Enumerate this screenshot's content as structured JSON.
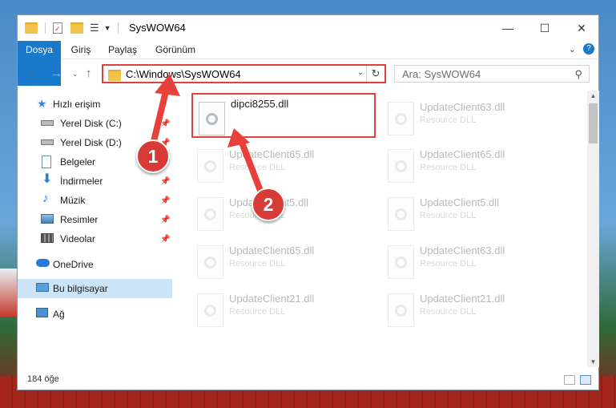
{
  "window": {
    "title": "SysWOW64",
    "controls": {
      "minimize": "—",
      "maximize": "☐",
      "close": "✕"
    }
  },
  "ribbon": {
    "tabs": [
      "Dosya",
      "Giriş",
      "Paylaş",
      "Görünüm"
    ],
    "help": "?"
  },
  "nav": {
    "address": "C:\\Windows\\SysWOW64",
    "search_placeholder": "Ara: SysWOW64"
  },
  "sidebar": {
    "items": [
      {
        "label": "Hızlı erişim",
        "icon": "star-icon"
      },
      {
        "label": "Yerel Disk (C:)",
        "icon": "drive-icon",
        "pinned": true
      },
      {
        "label": "Yerel Disk (D:)",
        "icon": "drive-icon",
        "pinned": true
      },
      {
        "label": "Belgeler",
        "icon": "documents-icon",
        "pinned": true
      },
      {
        "label": "İndirmeler",
        "icon": "download-icon",
        "pinned": true
      },
      {
        "label": "Müzik",
        "icon": "music-icon",
        "pinned": true
      },
      {
        "label": "Resimler",
        "icon": "pictures-icon",
        "pinned": true
      },
      {
        "label": "Videolar",
        "icon": "videos-icon",
        "pinned": true
      },
      {
        "label": "OneDrive",
        "icon": "cloud-icon"
      },
      {
        "label": "Bu bilgisayar",
        "icon": "computer-icon",
        "selected": true
      },
      {
        "label": "Ağ",
        "icon": "network-icon"
      }
    ]
  },
  "files": [
    {
      "name": "dipci8255.dll",
      "desc": "",
      "selected": true
    },
    {
      "name": "UpdateClient63.dll",
      "desc": "Resource DLL"
    },
    {
      "name": "UpdateClient65.dll",
      "desc": "Resource DLL"
    },
    {
      "name": "UpdateClient65.dll",
      "desc": "Resource DLL"
    },
    {
      "name": "UpdateClient5.dll",
      "desc": "Resource DLL"
    },
    {
      "name": "UpdateClient5.dll",
      "desc": "Resource DLL"
    },
    {
      "name": "UpdateClient65.dll",
      "desc": "Resource DLL"
    },
    {
      "name": "UpdateClient63.dll",
      "desc": "Resource DLL"
    },
    {
      "name": "UpdateClient21.dll",
      "desc": "Resource DLL"
    },
    {
      "name": "UpdateClient21.dll",
      "desc": "Resource DLL"
    }
  ],
  "status": {
    "item_count": "184 öğe"
  },
  "callouts": [
    "1",
    "2"
  ],
  "colors": {
    "accent": "#1979ca",
    "highlight": "#e0413c",
    "callout": "#d83a35",
    "selected_nav": "#cce4f7"
  }
}
